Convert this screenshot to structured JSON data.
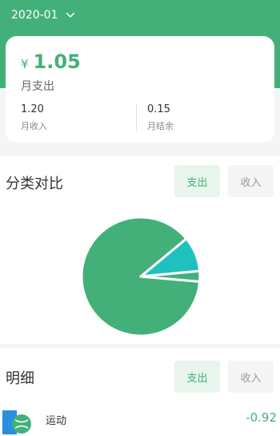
{
  "header": {
    "month": "2020-01",
    "dropdown_icon": "chevron-down-icon",
    "bg_color": "#43b07a"
  },
  "summary": {
    "currency": "¥",
    "amount": "1.05",
    "amount_label": "月支出",
    "income_value": "1.20",
    "income_label": "月收入",
    "balance_value": "0.15",
    "balance_label": "月结余"
  },
  "category": {
    "title": "分类对比",
    "expense_label": "支出",
    "income_label": "收入",
    "active": "expense"
  },
  "chart_data": {
    "type": "pie",
    "slices": [
      {
        "value": 0.92,
        "color": "#43b07a",
        "highlight": false
      },
      {
        "value": 0.1,
        "color": "#1fc1be",
        "highlight": false
      },
      {
        "value": 0.03,
        "color": "#43b07a",
        "highlight": false
      }
    ]
  },
  "detail": {
    "title": "明细",
    "expense_label": "支出",
    "income_label": "收入",
    "active": "expense",
    "items": [
      {
        "name": "运动",
        "amount": "-0.92",
        "icon": "sport-icon"
      }
    ]
  },
  "colors": {
    "accent": "#43b07a",
    "accent_light": "#e7f5ec",
    "teal": "#1fc1be"
  }
}
